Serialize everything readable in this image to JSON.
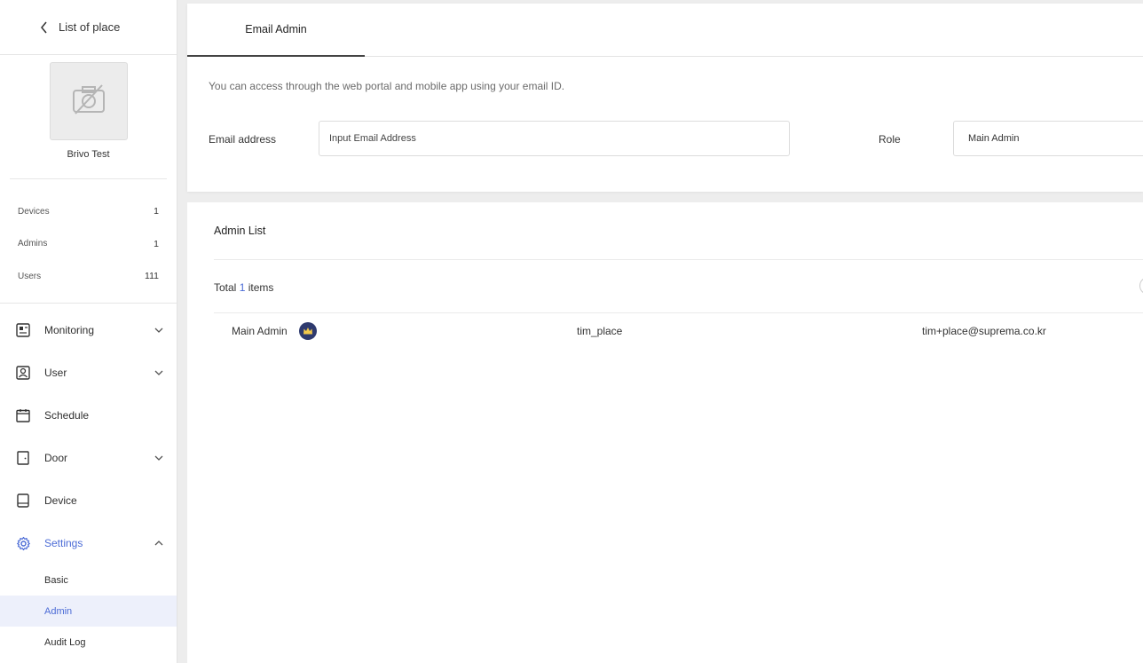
{
  "sidebar": {
    "back_label": "List of place",
    "place_name": "Brivo Test",
    "stats": [
      {
        "label": "Devices",
        "value": "1"
      },
      {
        "label": "Admins",
        "value": "1"
      },
      {
        "label": "Users",
        "value": "111"
      }
    ],
    "menu": {
      "monitoring": "Monitoring",
      "user": "User",
      "schedule": "Schedule",
      "door": "Door",
      "device": "Device",
      "settings": "Settings"
    },
    "settings_sub": {
      "basic": "Basic",
      "admin": "Admin",
      "audit_log": "Audit Log"
    },
    "accent_color": "#4b6bd6"
  },
  "email_admin": {
    "tab_label": "Email Admin",
    "description": "You can access through the web portal and mobile app using your email ID.",
    "email_label": "Email address",
    "email_placeholder": "Input Email Address",
    "email_value": "",
    "role_label": "Role",
    "role_value": "Main Admin"
  },
  "admin_list": {
    "title": "Admin List",
    "total_prefix": "Total",
    "total_count": "1",
    "total_suffix": "items",
    "rows": [
      {
        "role": "Main Admin",
        "badge_icon": "crown-icon",
        "username": "tim_place",
        "email": "tim+place@suprema.co.kr"
      }
    ]
  }
}
